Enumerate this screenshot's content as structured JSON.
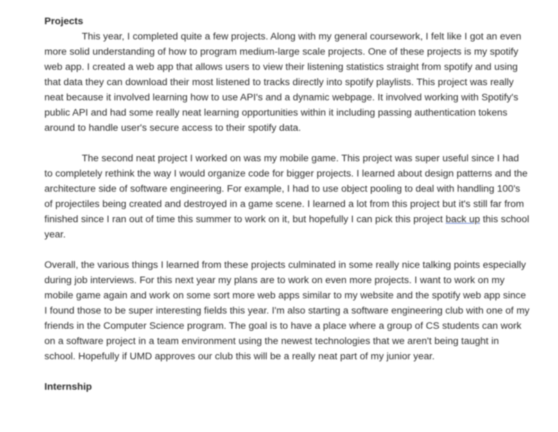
{
  "document": {
    "section_heading": "Projects",
    "paragraphs": [
      {
        "text": "This year, I completed quite a few projects. Along with my general coursework, I felt like I got an even more solid understanding of how to program medium-large scale projects. One of these projects is my spotify web app. I created a web app that allows users to view their listening statistics straight from spotify and using that data they can download their most listened to tracks directly into spotify playlists. This project was really neat because it involved learning how to use API's and a dynamic webpage. It involved working with Spotify's public API and had some really neat learning opportunities within it including passing authentication tokens around to handle user's secure access to their spotify data."
      },
      {
        "text_before_link": "The second neat project I worked on was my mobile game. This project was super useful since I had to completely rethink the way I would organize code for bigger projects. I learned about design patterns and the architecture side of software engineering. For example, I had to use object pooling to deal with handling 100's of projectiles being created and destroyed in a game scene. I learned a lot from this project but it's still far from finished since I ran out of time this summer to work on it, but hopefully I can pick this project ",
        "link_text": "back up",
        "text_after_link": " this school year."
      },
      {
        "text": "Overall, the various things I learned from these projects culminated in some really nice talking points especially during job interviews. For this next year my plans are to work on even more projects. I want to work on my mobile game again and work on some sort more web apps similar to my website and the spotify web app since I found those to be super interesting fields this year. I'm also starting a software engineering club with one of my friends in the Computer Science program. The goal is to have a place where a group of CS students can work on a software project in a team environment using the newest technologies that we aren't being taught in school. Hopefully if UMD approves our club this will be a really neat part of my junior year."
      }
    ],
    "next_heading": "Internship"
  }
}
